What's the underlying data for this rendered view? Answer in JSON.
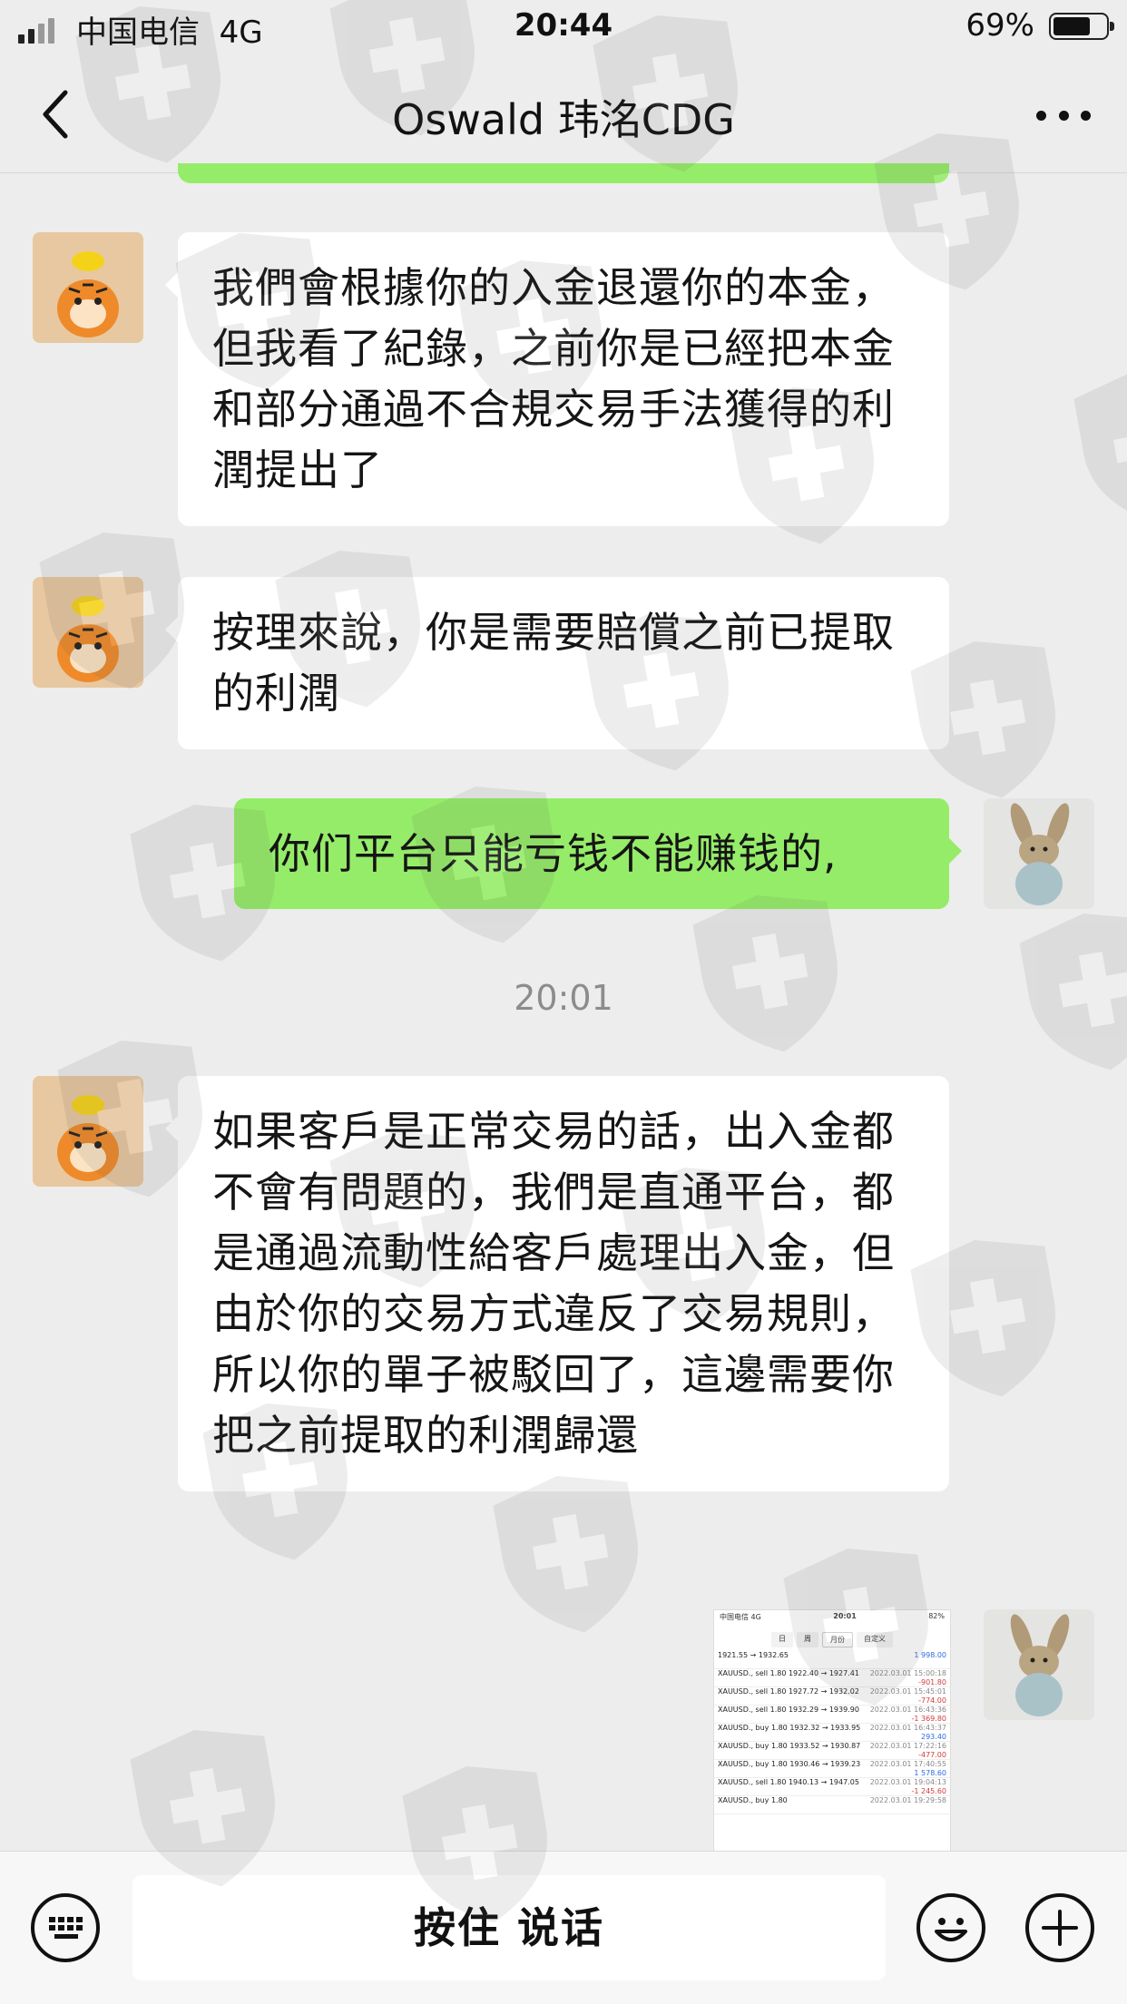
{
  "status_bar": {
    "carrier": "中国电信",
    "network": "4G",
    "time": "20:44",
    "battery_percent": "69%"
  },
  "nav": {
    "title": "Oswald 玮洺CDG",
    "back_icon": "chevron-left-icon",
    "more_icon": "more-dots-icon"
  },
  "messages": [
    {
      "sender": "contact",
      "text": "我們會根據你的入金退還你的本金，但我看了紀錄，之前你是已經把本金和部分通過不合規交易手法獲得的利潤提出了"
    },
    {
      "sender": "contact",
      "text": "按理來說，你是需要賠償之前已提取的利潤"
    },
    {
      "sender": "me",
      "text": "你们平台只能亏钱不能赚钱的,"
    },
    {
      "sender": "contact",
      "text": "如果客戶是正常交易的話，出入金都不會有問題的，我們是直通平台，都是通過流動性給客戶處理出入金，但由於你的交易方式違反了交易規則，所以你的單子被駁回了，這邊需要你把之前提取的利潤歸還"
    }
  ],
  "timestamp": "20:01",
  "image_message": {
    "status_left": "中国电信 4G",
    "status_time": "20:01",
    "status_right": "82%",
    "tabs": [
      "日",
      "周",
      "月份",
      "自定义"
    ],
    "active_tab": "月份",
    "rows": [
      {
        "left": "1921.55 → 1932.65",
        "right_top": "",
        "right": "1 998.00",
        "sign": "pos"
      },
      {
        "left": "XAUUSD., sell 1.80  1922.40 → 1927.41",
        "right_top": "2022.03.01 15:00:18",
        "right": "-901.80",
        "sign": "neg"
      },
      {
        "left": "XAUUSD., sell 1.80  1927.72 → 1932.02",
        "right_top": "2022.03.01 15:45:01",
        "right": "-774.00",
        "sign": "neg"
      },
      {
        "left": "XAUUSD., sell 1.80  1932.29 → 1939.90",
        "right_top": "2022.03.01 16:43:36",
        "right": "-1 369.80",
        "sign": "neg"
      },
      {
        "left": "XAUUSD., buy 1.80  1932.32 → 1933.95",
        "right_top": "2022.03.01 16:43:37",
        "right": "293.40",
        "sign": "pos"
      },
      {
        "left": "XAUUSD., buy 1.80  1933.52 → 1930.87",
        "right_top": "2022.03.01 17:22:16",
        "right": "-477.00",
        "sign": "neg"
      },
      {
        "left": "XAUUSD., buy 1.80  1930.46 → 1939.23",
        "right_top": "2022.03.01 17:40:55",
        "right": "1 578.60",
        "sign": "pos"
      },
      {
        "left": "XAUUSD., sell 1.80  1940.13 → 1947.05",
        "right_top": "2022.03.01 19:04:13",
        "right": "-1 245.60",
        "sign": "neg"
      },
      {
        "left": "XAUUSD., buy 1.80",
        "right_top": "2022.03.01 19:29:58",
        "right": "",
        "sign": "pos"
      }
    ]
  },
  "input_bar": {
    "hold_to_talk": "按住 说话",
    "keyboard_icon": "keyboard-icon",
    "emoji_icon": "emoji-icon",
    "plus_icon": "plus-icon"
  },
  "colors": {
    "background": "#ededed",
    "outgoing_bubble": "#95ec69",
    "incoming_bubble": "#ffffff"
  }
}
